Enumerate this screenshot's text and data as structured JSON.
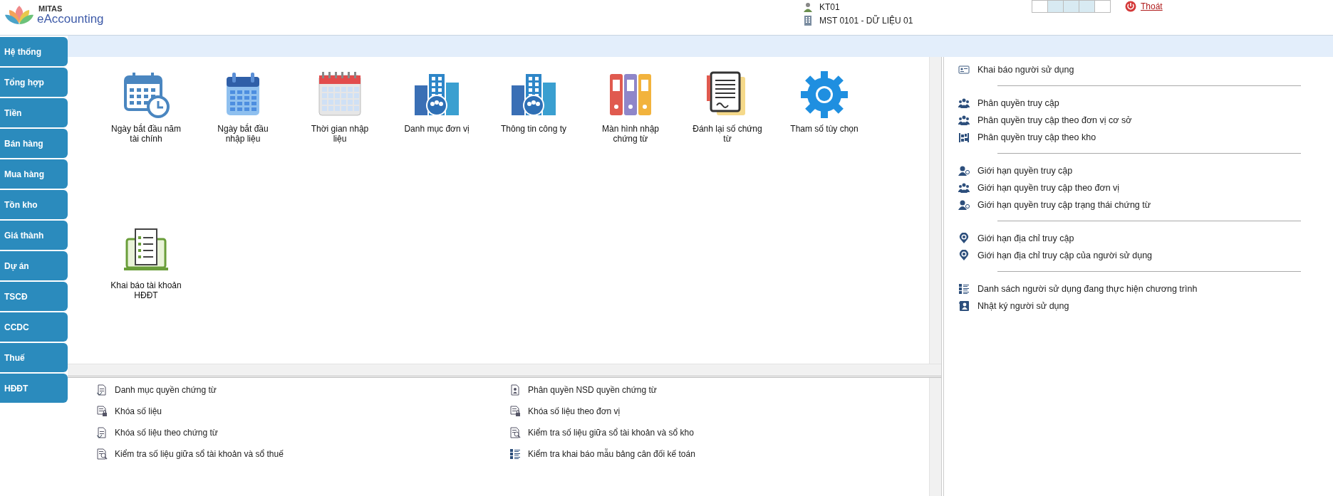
{
  "header": {
    "logo": {
      "brand": "MITAS",
      "product": "eAccounting"
    },
    "user": "KT01",
    "company": "MST 0101 - DỮ LIỆU 01",
    "logout": "Thoát"
  },
  "sidebar": {
    "items": [
      {
        "label": "Hệ thống"
      },
      {
        "label": "Tổng hợp"
      },
      {
        "label": "Tiền"
      },
      {
        "label": "Bán hàng"
      },
      {
        "label": "Mua hàng"
      },
      {
        "label": "Tồn kho"
      },
      {
        "label": "Giá thành"
      },
      {
        "label": "Dự án"
      },
      {
        "label": "TSCĐ"
      },
      {
        "label": "CCDC"
      },
      {
        "label": "Thuế"
      },
      {
        "label": "HĐĐT"
      }
    ]
  },
  "tiles": [
    {
      "label": "Ngày bắt đầu năm tài chính",
      "kind": "calendar-clock"
    },
    {
      "label": "Ngày bắt đầu nhập liệu",
      "kind": "calendar"
    },
    {
      "label": "Thời gian nhập liệu",
      "kind": "calendar-grid"
    },
    {
      "label": "Danh mục đơn vị",
      "kind": "buildings"
    },
    {
      "label": "Thông tin công ty",
      "kind": "buildings"
    },
    {
      "label": "Màn hình nhập chứng từ",
      "kind": "binders"
    },
    {
      "label": "Đánh lại số chứng từ",
      "kind": "document"
    },
    {
      "label": "Tham số tùy chọn",
      "kind": "gear"
    },
    {
      "label": "Khai báo tài khoản HĐĐT",
      "kind": "receipt"
    }
  ],
  "bottom_links": [
    {
      "label": "Danh mục quyền chứng từ",
      "kind": "doc"
    },
    {
      "label": "Phân quyền NSD quyền chứng từ",
      "kind": "doc-user"
    },
    {
      "label": "Khóa số liệu",
      "kind": "lock"
    },
    {
      "label": "Khóa số liệu theo đơn vị",
      "kind": "lock"
    },
    {
      "label": "Khóa số liệu theo chứng từ",
      "kind": "doc"
    },
    {
      "label": "Kiểm tra số liệu giữa sổ tài khoản và sổ kho",
      "kind": "check"
    },
    {
      "label": "Kiểm tra số liệu giữa sổ tài khoản và sổ thuế",
      "kind": "check"
    },
    {
      "label": "Kiểm tra khai báo mẫu bảng cân đối kế toán",
      "kind": "list"
    }
  ],
  "right_menu": {
    "groups": [
      [
        {
          "label": "Khai báo người sử dụng",
          "kind": "id-card"
        }
      ],
      [
        {
          "label": "Phân quyền truy cập",
          "kind": "group"
        },
        {
          "label": "Phân quyền truy cập theo đơn vị cơ sở",
          "kind": "group"
        },
        {
          "label": "Phân quyền truy cập theo kho",
          "kind": "warehouse"
        }
      ],
      [
        {
          "label": "Giới hạn quyền truy cập",
          "kind": "user"
        },
        {
          "label": "Giới hạn quyền truy cập theo đơn vị",
          "kind": "group"
        },
        {
          "label": "Giới hạn quyền truy cập trạng thái chứng từ",
          "kind": "user"
        }
      ],
      [
        {
          "label": "Giới hạn địa chỉ truy cập",
          "kind": "pin"
        },
        {
          "label": "Giới hạn địa chỉ truy cập của người sử dụng",
          "kind": "pin"
        }
      ],
      [
        {
          "label": "Danh sách người sử dụng đang thực hiện chương trình",
          "kind": "list"
        },
        {
          "label": "Nhật ký người sử dụng",
          "kind": "journal"
        }
      ]
    ]
  }
}
